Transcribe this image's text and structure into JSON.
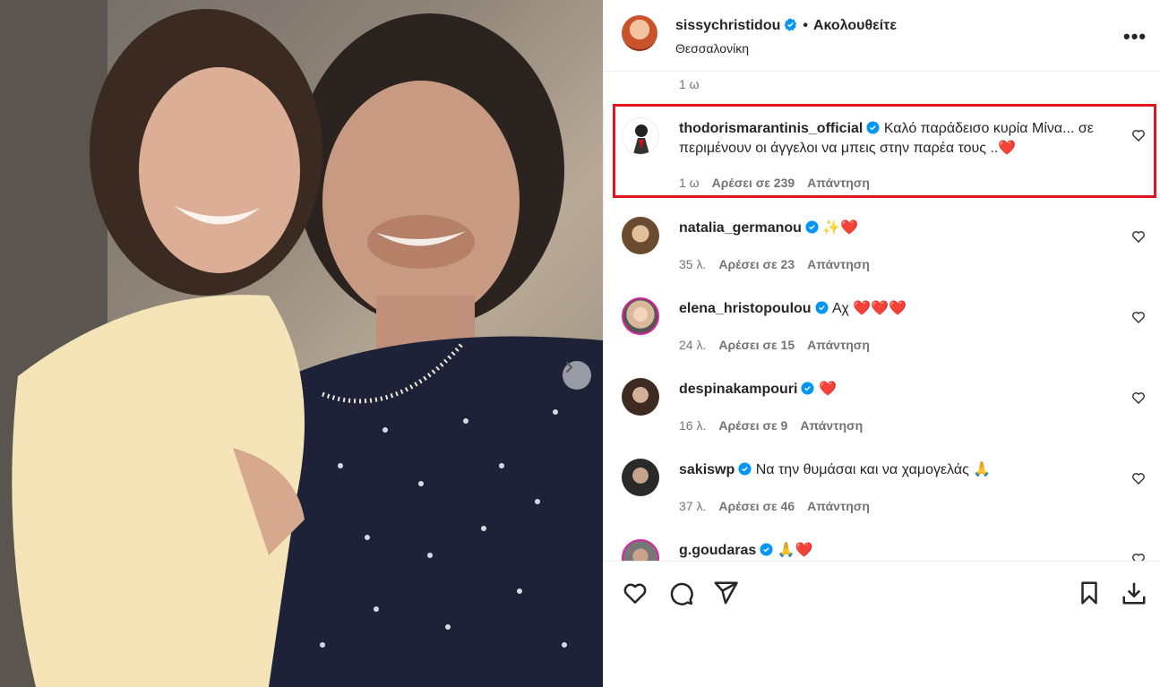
{
  "post": {
    "carousel_next_icon": "chevron-right-icon"
  },
  "header": {
    "username": "sissychristidou",
    "separator": "•",
    "follow_label": "Ακολουθείτε",
    "location": "Θεσσαλονίκη",
    "more_icon": "more-horizontal-icon",
    "more_label": "•••"
  },
  "top_time": "1 ω",
  "comments": [
    {
      "user": "thodorismarantinis_official",
      "text": "Καλό παράδεισο κυρία Μίνα... σε περιμένουν οι άγγελοι να μπεις στην παρέα τους ..❤️",
      "time": "1 ω",
      "likes": "Αρέσει σε 239",
      "reply": "Απάντηση",
      "highlighted": true
    },
    {
      "user": "natalia_germanou",
      "text": "✨❤️",
      "time": "35 λ.",
      "likes": "Αρέσει σε 23",
      "reply": "Απάντηση"
    },
    {
      "user": "elena_hristopoulou",
      "text": "Αχ ❤️❤️❤️",
      "time": "24 λ.",
      "likes": "Αρέσει σε 15",
      "reply": "Απάντηση"
    },
    {
      "user": "despinakampouri",
      "text": "❤️",
      "time": "16 λ.",
      "likes": "Αρέσει σε 9",
      "reply": "Απάντηση"
    },
    {
      "user": "sakiswp",
      "text": "Να την θυμάσαι και να χαμογελάς 🙏",
      "time": "37 λ.",
      "likes": "Αρέσει σε 46",
      "reply": "Απάντηση"
    },
    {
      "user": "g.goudaras",
      "text": "🙏❤️",
      "time": "",
      "likes": "",
      "reply": ""
    }
  ],
  "actions": {
    "like_icon": "heart-icon",
    "comment_icon": "comment-icon",
    "share_icon": "send-icon",
    "save_icon": "bookmark-icon",
    "download_icon": "download-icon"
  },
  "colors": {
    "verified": "#0095f6",
    "highlight_border": "#e0151f",
    "muted_text": "#737373"
  }
}
